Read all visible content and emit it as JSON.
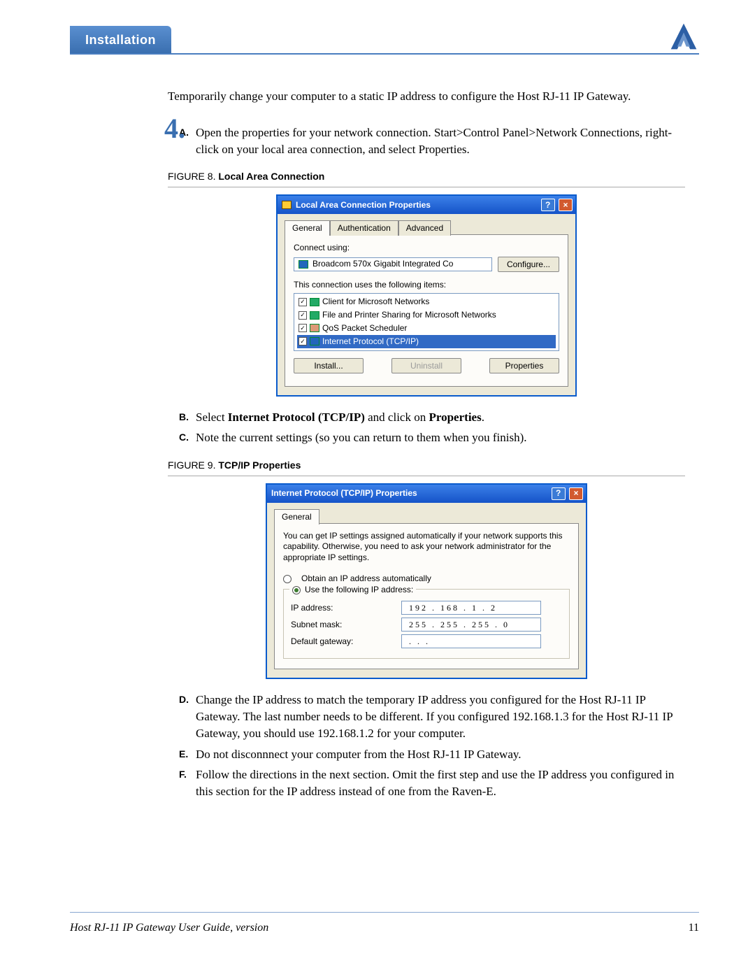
{
  "header": {
    "section_title": "Installation"
  },
  "step": {
    "number": "4.",
    "intro": "Temporarily change your computer to a static IP address to configure the Host RJ-11 IP Gateway."
  },
  "substeps": {
    "A": {
      "letter": "A.",
      "text": "Open the properties for your network connection. Start>Control Panel>Network Connections, right-click on your local area connection, and select Properties."
    },
    "B": {
      "letter": "B.",
      "prefix": "Select ",
      "bold1": "Internet Protocol (TCP/IP)",
      "mid": " and click on ",
      "bold2": "Properties",
      "suffix": "."
    },
    "C": {
      "letter": "C.",
      "text": "Note the current settings (so you can return to them when you finish)."
    },
    "D": {
      "letter": "D.",
      "text": "Change the IP address to match the temporary IP address you configured for the Host RJ-11 IP Gateway.  The last number needs to be different.  If you configured 192.168.1.3 for the Host RJ-11 IP Gateway, you should use 192.168.1.2 for your computer."
    },
    "E": {
      "letter": "E.",
      "text": "Do not disconnnect your computer from the Host RJ-11 IP Gateway."
    },
    "F": {
      "letter": "F.",
      "text": "Follow the directions in the next section.  Omit the first step and use the IP address you configured in this section for the IP address instead of one from the Raven-E."
    }
  },
  "figures": {
    "f8": {
      "label": "FIGURE 8.",
      "title": "Local Area Connection"
    },
    "f9": {
      "label": "FIGURE 9.",
      "title": "TCP/IP Properties"
    }
  },
  "dialog1": {
    "title": "Local Area Connection Properties",
    "tabs": {
      "t1": "General",
      "t2": "Authentication",
      "t3": "Advanced"
    },
    "connect_label": "Connect using:",
    "adapter": "Broadcom 570x Gigabit Integrated Co",
    "configure_btn": "Configure...",
    "items_label": "This connection uses the following items:",
    "items": {
      "i1": "Client for Microsoft Networks",
      "i2": "File and Printer Sharing for Microsoft Networks",
      "i3": "QoS Packet Scheduler",
      "i4": "Internet Protocol (TCP/IP)"
    },
    "buttons": {
      "install": "Install...",
      "uninstall": "Uninstall",
      "properties": "Properties"
    }
  },
  "dialog2": {
    "title": "Internet Protocol (TCP/IP) Properties",
    "tab": "General",
    "desc": "You can get IP settings assigned automatically if your network supports this capability. Otherwise, you need to ask your network administrator for the appropriate IP settings.",
    "radio_auto": "Obtain an IP address automatically",
    "radio_manual": "Use the following IP address:",
    "ip_label": "IP address:",
    "ip_value": "192 . 168 .   1   .   2",
    "subnet_label": "Subnet mask:",
    "subnet_value": "255 . 255 . 255 .   0",
    "gw_label": "Default gateway:",
    "gw_value": "     .        .        .     "
  },
  "footer": {
    "guide": "Host RJ-11 IP Gateway User Guide, version",
    "page": "11"
  }
}
